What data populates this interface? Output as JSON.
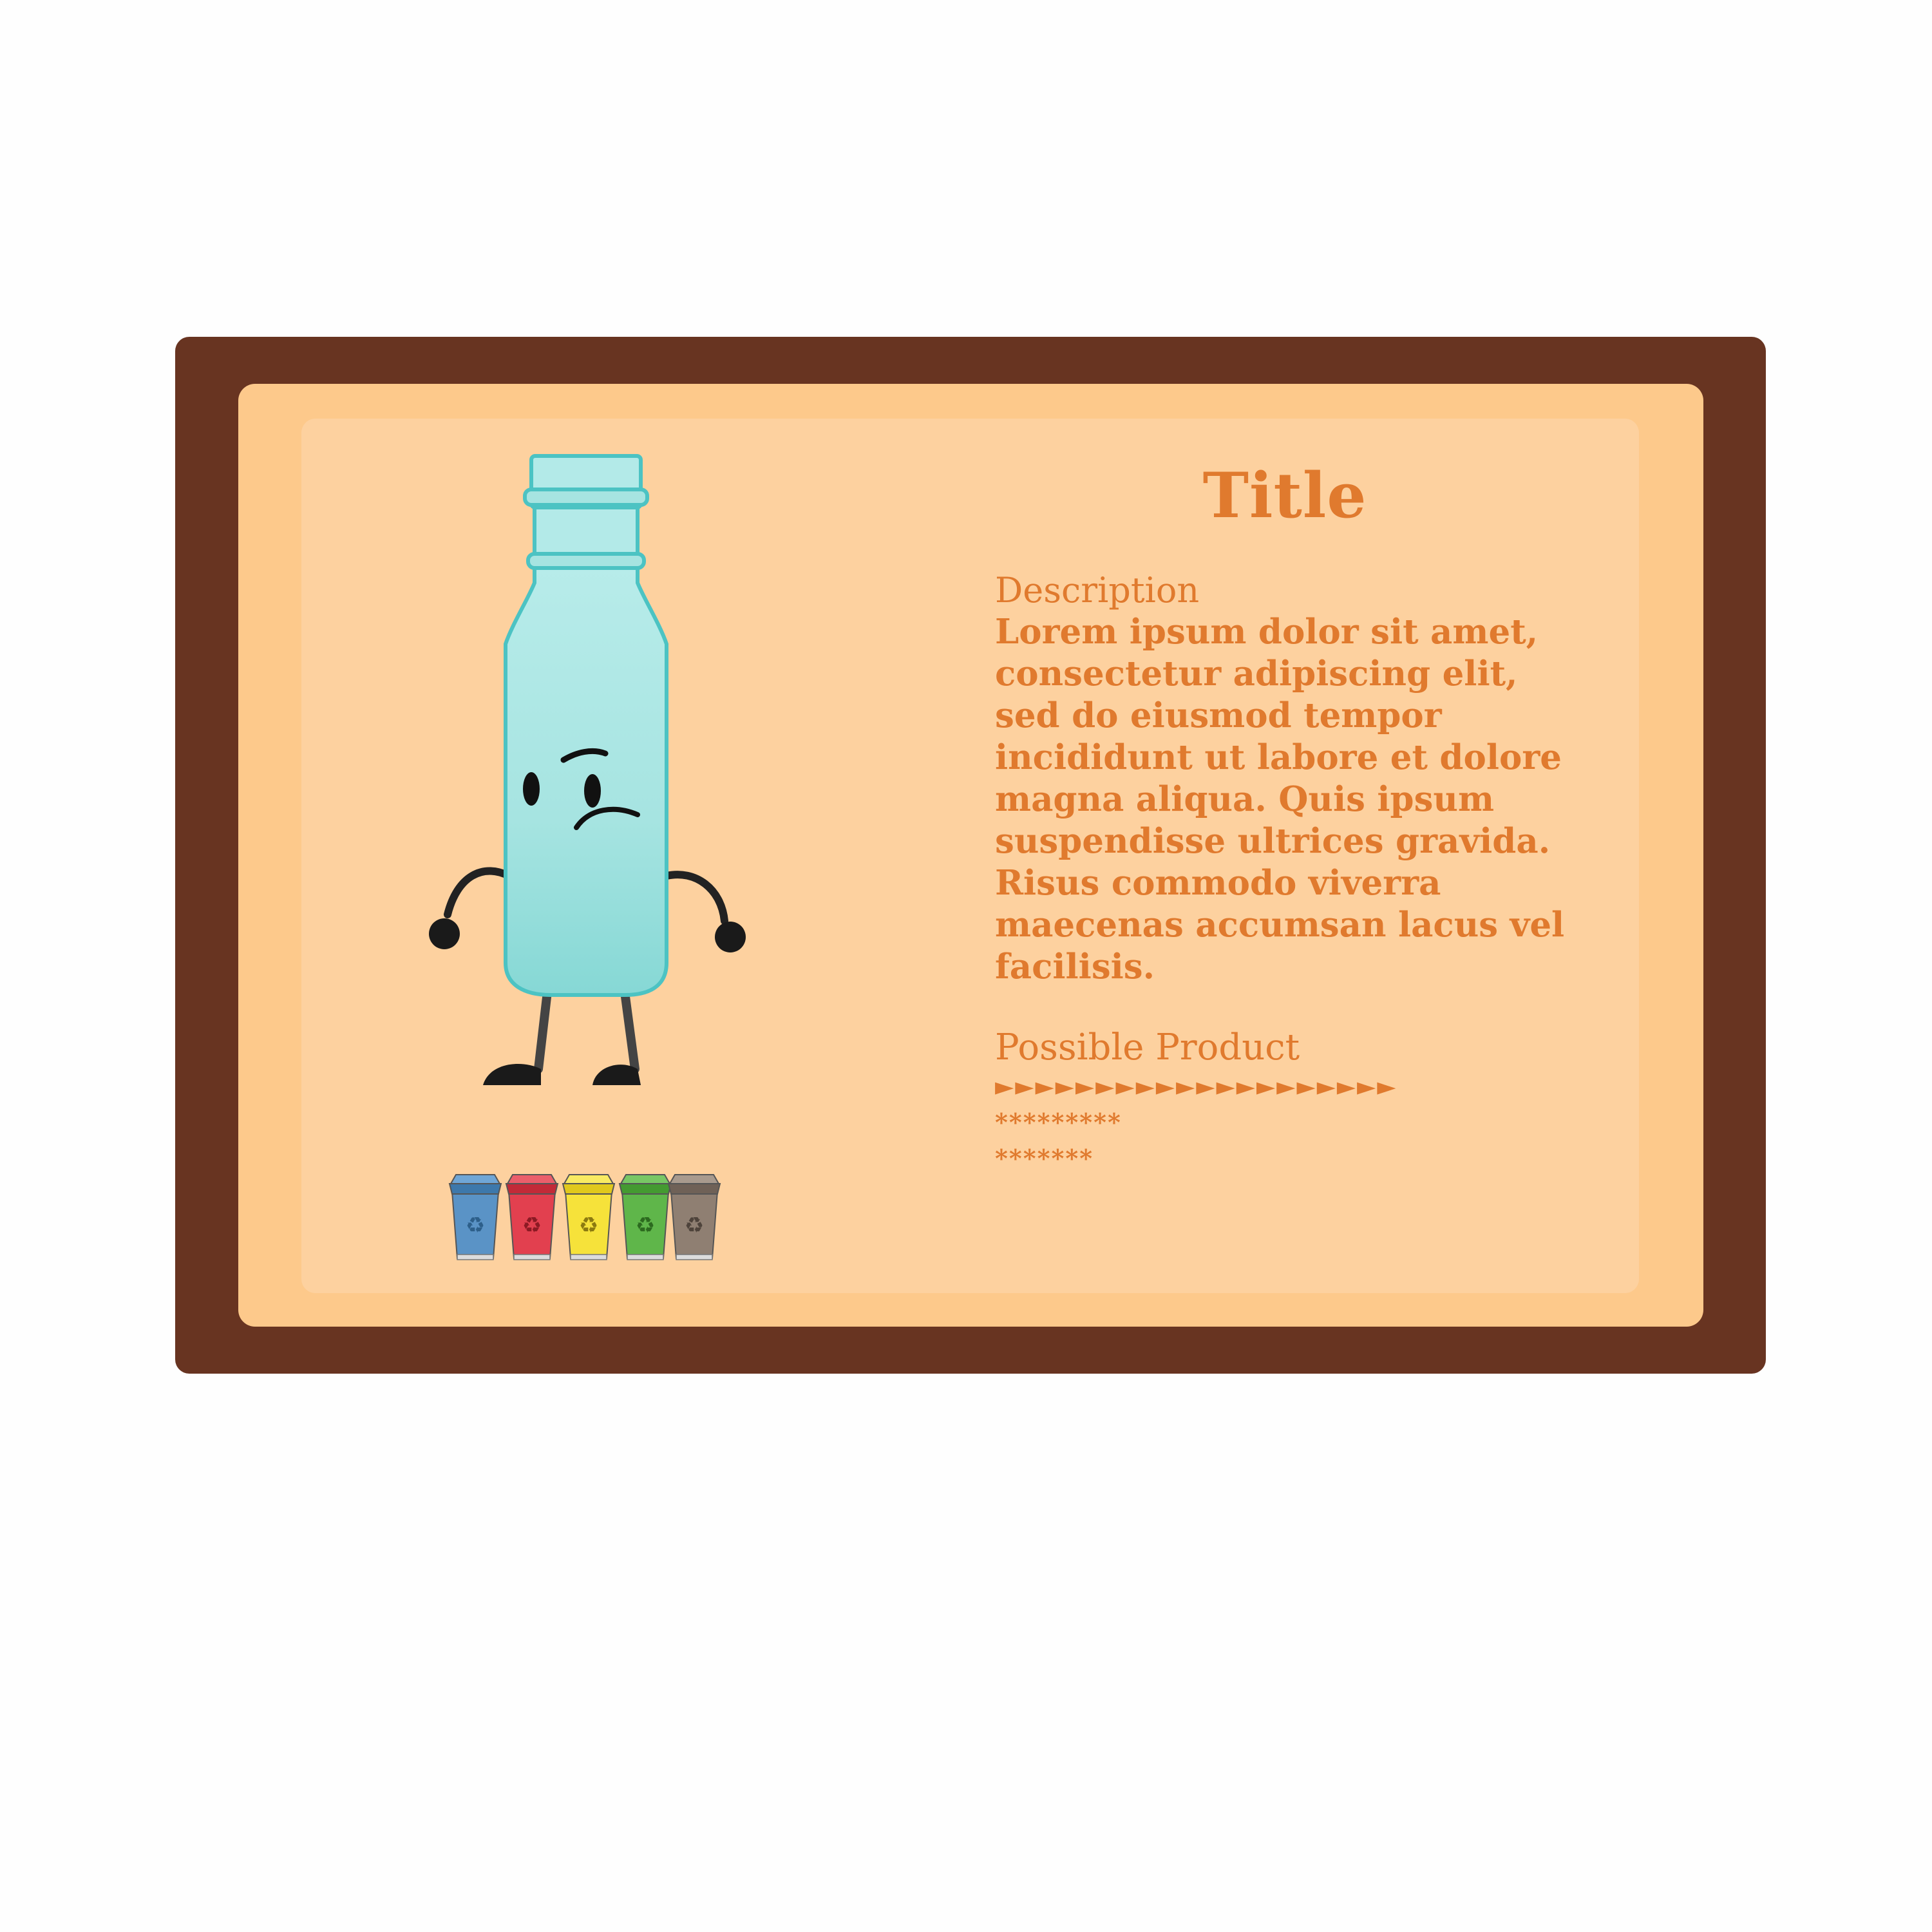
{
  "card": {
    "title": "Title",
    "description_heading": "Description",
    "description_body": "Lorem ipsum dolor sit amet,\nconsectetur adipiscing elit,\nsed do eiusmod tempor\nincididunt ut labore et dolore\nmagna aliqua. Quis ipsum\nsuspendisse ultrices gravida.\nRisus commodo viverra\nmaecenas accumsan lacus vel\nfacilisis.",
    "product_heading": "Possible Product",
    "product_lines": [
      "►►►►►►►►►►►►►►►►►►►►",
      "*********",
      "*******"
    ]
  },
  "colors": {
    "frame_outer": "#683421",
    "frame_mid": "#fdc98b",
    "frame_inner": "#fdd19f",
    "text": "#e07a2e",
    "bottle": "#8fdcd9",
    "bottle_outline": "#4cc3c3"
  },
  "illustration": {
    "character": "sad-water-bottle-icon",
    "bins": [
      {
        "name": "blue-recycle-bin-icon",
        "color": "#5a93c6"
      },
      {
        "name": "red-recycle-bin-icon",
        "color": "#e2404f"
      },
      {
        "name": "yellow-recycle-bin-icon",
        "color": "#f6e23a"
      },
      {
        "name": "green-recycle-bin-icon",
        "color": "#5fb64a"
      },
      {
        "name": "gray-recycle-bin-icon",
        "color": "#8f7f72"
      }
    ]
  }
}
